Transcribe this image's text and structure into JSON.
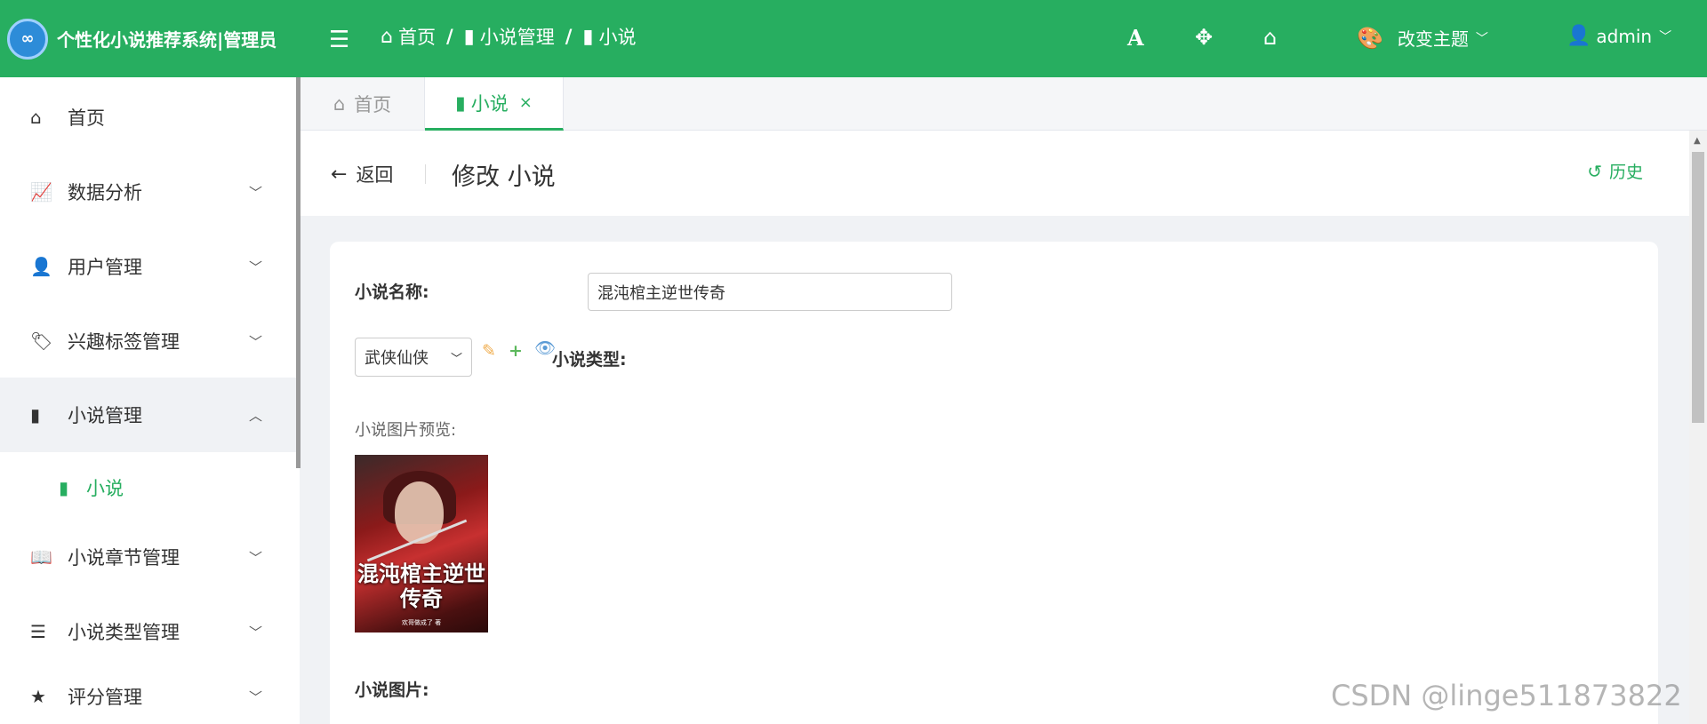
{
  "header": {
    "title": "个性化小说推荐系统|管理员",
    "logo_text": "∞",
    "breadcrumb": [
      {
        "label": "首页",
        "icon": "home-icon"
      },
      {
        "label": "小说管理",
        "icon": "book-icon"
      },
      {
        "label": "小说",
        "icon": "book-icon"
      }
    ],
    "breadcrumb_sep": "/",
    "theme_label": "改变主题",
    "user_label": "admin"
  },
  "sidebar": {
    "items": [
      {
        "label": "首页",
        "icon": "home-icon"
      },
      {
        "label": "数据分析",
        "icon": "chart-line-icon"
      },
      {
        "label": "用户管理",
        "icon": "user-icon"
      },
      {
        "label": "兴趣标签管理",
        "icon": "tags-icon"
      },
      {
        "label": "小说管理",
        "icon": "book-icon"
      },
      {
        "label": "小说章节管理",
        "icon": "book-reader-icon"
      },
      {
        "label": "小说类型管理",
        "icon": "list-icon"
      },
      {
        "label": "评分管理",
        "icon": "star-icon"
      }
    ],
    "sub_item": {
      "label": "小说",
      "icon": "book-icon"
    }
  },
  "tabs": [
    {
      "label": "首页",
      "icon": "home-icon"
    },
    {
      "label": "小说",
      "icon": "book-icon",
      "close": "×"
    }
  ],
  "page": {
    "back_label": "返回",
    "title": "修改 小说",
    "history_label": "历史"
  },
  "form": {
    "name_label": "小说名称:",
    "name_value": "混沌棺主逆世传奇",
    "type_selected": "武侠仙侠",
    "type_label": "小说类型:",
    "preview_label": "小说图片预览:",
    "cover_title": "混沌棺主逆世传奇",
    "cover_subtitle": "欢哥做成了 著",
    "image_label": "小说图片:"
  },
  "watermark": "CSDN @linge511873822",
  "colors": {
    "primary": "#27ae60",
    "edit": "#f0ad4e",
    "add": "#5cb85c",
    "view": "#5b9bd5"
  }
}
